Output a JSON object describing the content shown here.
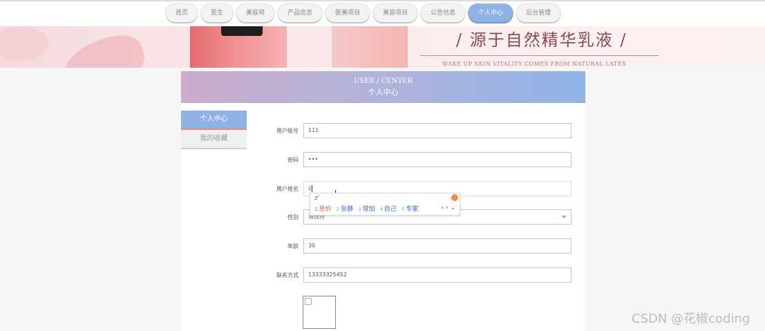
{
  "nav": {
    "items": [
      "首页",
      "医生",
      "美容师",
      "产品信息",
      "医美项目",
      "美容项目",
      "公告信息",
      "个人中心",
      "后台管理"
    ],
    "active_index": 7
  },
  "banner": {
    "title": "/ 源于自然精华乳液 /",
    "subtitle": "WAKE UP SKIN VITALITY COMES FROM NATURAL LATEX"
  },
  "panel": {
    "header_en": "USER / CENTER",
    "header_cn": "个人中心"
  },
  "sidebar": {
    "items": [
      "个人中心",
      "我的收藏"
    ]
  },
  "form": {
    "account": {
      "label": "用户账号",
      "value": "111"
    },
    "password": {
      "label": "密码",
      "value": "•••"
    },
    "name": {
      "label": "用户姓名",
      "value": "z"
    },
    "gender": {
      "label": "性别",
      "placeholder": "请选择"
    },
    "age": {
      "label": "年龄",
      "value": "30"
    },
    "contact": {
      "label": "联系方式",
      "value": "13333325452"
    }
  },
  "ime": {
    "pinyin": "z'",
    "candidates": [
      {
        "n": "1",
        "text": "总价"
      },
      {
        "n": "2",
        "text": "张静"
      },
      {
        "n": "3",
        "text": "增加"
      },
      {
        "n": "4",
        "text": "自己"
      },
      {
        "n": "5",
        "text": "专家"
      }
    ],
    "arrows": "‹ › ⌄"
  },
  "watermark": "CSDN @花椒coding"
}
